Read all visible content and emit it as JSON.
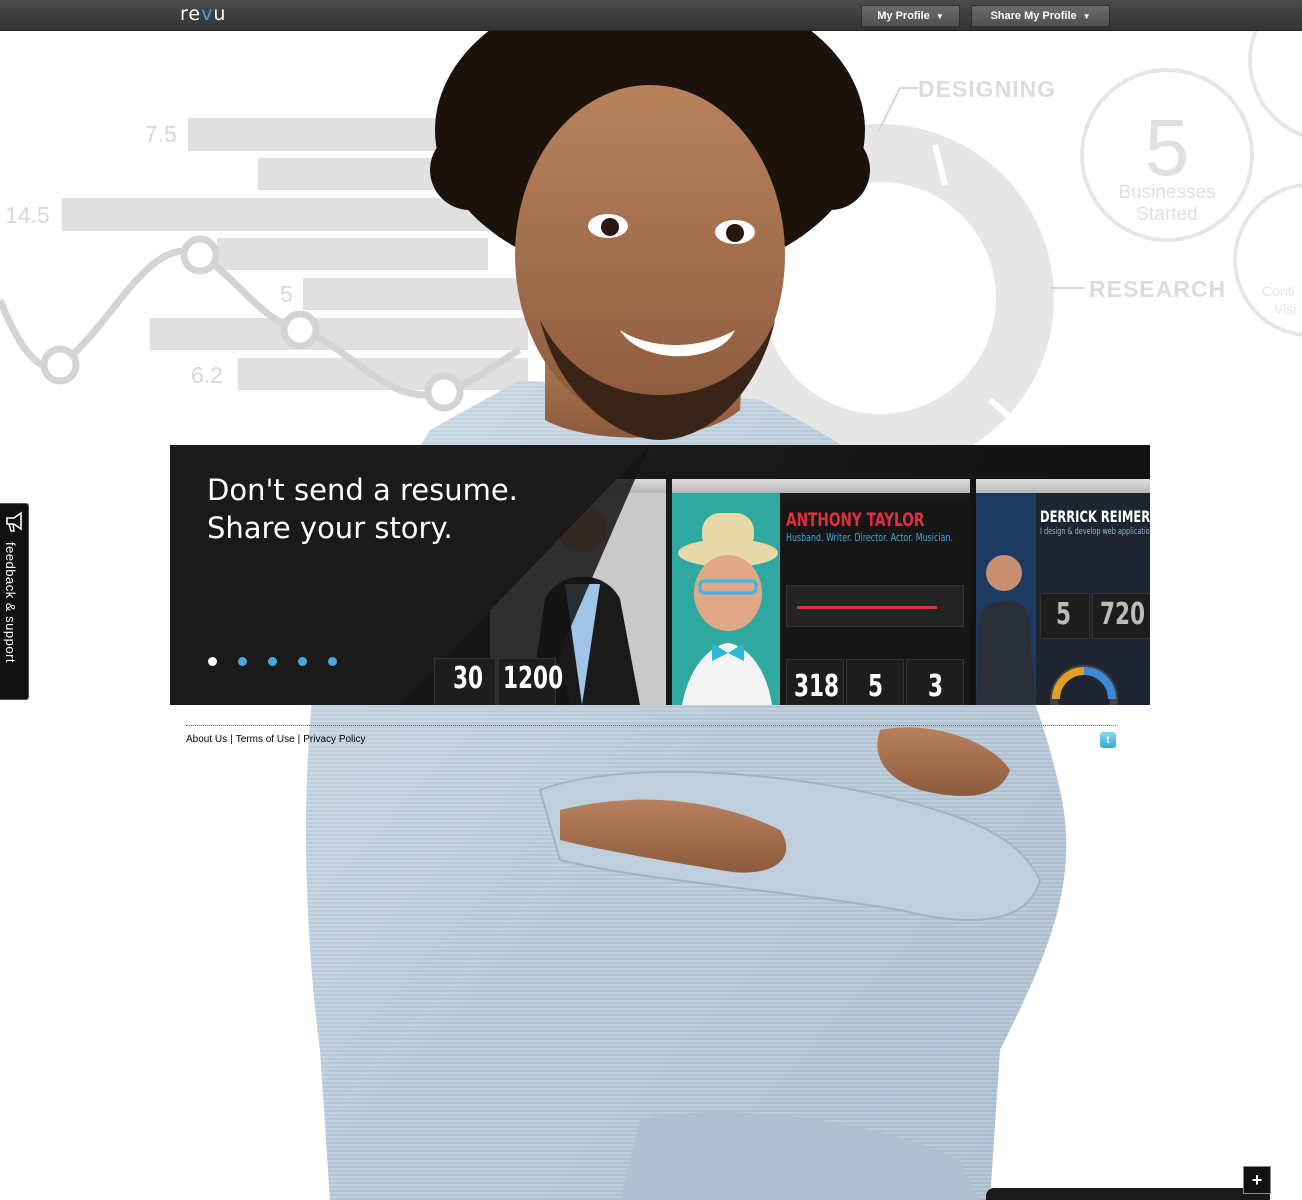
{
  "header": {
    "logo_text": "re",
    "logo_dot": "v",
    "logo_end": "u",
    "my_profile_label": "My Profile",
    "share_profile_label": "Share My Profile",
    "caret": "▼"
  },
  "background": {
    "bar_labels": [
      "7.5",
      "14.5",
      "5",
      "6.2"
    ],
    "donut_labels": [
      "DESIGNING",
      "RESEARCH"
    ],
    "stat_big": "5",
    "stat_caption_1": "Businesses",
    "stat_caption_2": "Started",
    "cut_caption_1": "Conti",
    "cut_caption_2": "Visi"
  },
  "banner": {
    "tagline_line1": "Don't send a resume.",
    "tagline_line2": "Share your story.",
    "slide_count": 5,
    "active_slide": 1,
    "slide1_stats": [
      "30",
      "1200"
    ],
    "slide2_name": "ANTHONY TAYLOR",
    "slide2_subtitle": "Husband. Writer. Director. Actor. Musician.",
    "slide2_stats": [
      "318",
      "5",
      "3"
    ],
    "slide3_name": "DERRICK REIMER",
    "slide3_subtitle": "I design & develop web applications.",
    "slide3_stats": [
      "5",
      "720"
    ]
  },
  "footer": {
    "about": "About Us",
    "terms": "Terms of Use",
    "privacy": "Privacy Policy",
    "separator": "|",
    "twitter_glyph": "t"
  },
  "feedback": {
    "label": "feedback & support"
  },
  "widget": {
    "plus": "+"
  },
  "colors": {
    "accent_blue": "#4aa8e0",
    "banner_bg": "#141414",
    "highlight_red": "#e03040"
  }
}
